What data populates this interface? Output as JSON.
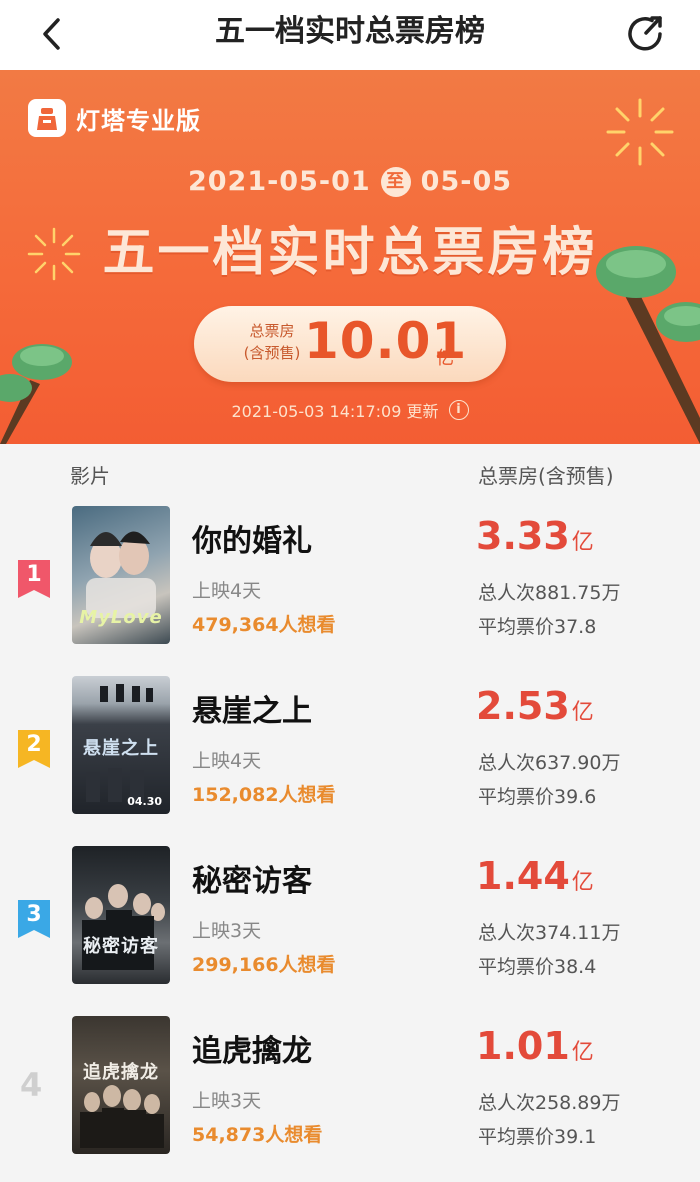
{
  "nav": {
    "title": "五一档实时总票房榜"
  },
  "banner": {
    "brand": "灯塔专业版",
    "date_start": "2021-05-01",
    "date_sep": "至",
    "date_end": "05-05",
    "title": "五一档实时总票房榜",
    "total_label_line1": "总票房",
    "total_label_line2": "(含预售)",
    "total_value": "10.01",
    "total_unit": "亿",
    "update_time": "2021-05-03 14:17:09 更新",
    "info_glyph": "i"
  },
  "table": {
    "col_film": "影片",
    "col_box": "总票房(含预售)"
  },
  "films": [
    {
      "rank": "1",
      "title": "你的婚礼",
      "days": "上映4天",
      "want": "479,364人想看",
      "box": "3.33",
      "box_unit": "亿",
      "viewers": "总人次881.75万",
      "avg_price": "平均票价37.8",
      "poster_caption": "MyLove",
      "rank_color": "#f0576a"
    },
    {
      "rank": "2",
      "title": "悬崖之上",
      "days": "上映4天",
      "want": "152,082人想看",
      "box": "2.53",
      "box_unit": "亿",
      "viewers": "总人次637.90万",
      "avg_price": "平均票价39.6",
      "poster_caption": "悬崖之上",
      "poster_date": "04.30",
      "rank_color": "#f6b623"
    },
    {
      "rank": "3",
      "title": "秘密访客",
      "days": "上映3天",
      "want": "299,166人想看",
      "box": "1.44",
      "box_unit": "亿",
      "viewers": "总人次374.11万",
      "avg_price": "平均票价38.4",
      "poster_caption": "秘密访客",
      "rank_color": "#3aa8e6"
    },
    {
      "rank": "4",
      "title": "追虎擒龙",
      "days": "上映3天",
      "want": "54,873人想看",
      "box": "1.01",
      "box_unit": "亿",
      "viewers": "总人次258.89万",
      "avg_price": "平均票价39.1",
      "poster_caption": "追虎擒龙"
    }
  ]
}
